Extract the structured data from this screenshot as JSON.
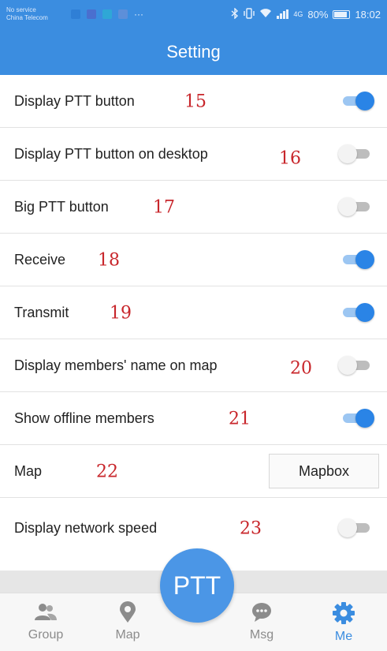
{
  "status_bar": {
    "carrier_line1": "No service",
    "carrier_line2": "China Telecom",
    "dots": "···",
    "icons": [
      "bluetooth-icon",
      "vibrate-icon",
      "wifi-icon",
      "signal-icon"
    ],
    "network": "4G",
    "battery": "80%",
    "time": "18:02"
  },
  "header": {
    "title": "Setting"
  },
  "settings": [
    {
      "label": "Display PTT button",
      "number": "15",
      "control": "toggle",
      "on": true
    },
    {
      "label": "Display PTT button on desktop",
      "number": "16",
      "control": "toggle",
      "on": false
    },
    {
      "label": "Big PTT button",
      "number": "17",
      "control": "toggle",
      "on": false
    },
    {
      "label": "Receive",
      "number": "18",
      "control": "toggle",
      "on": true
    },
    {
      "label": "Transmit",
      "number": "19",
      "control": "toggle",
      "on": true
    },
    {
      "label": "Display members' name on map",
      "number": "20",
      "control": "toggle",
      "on": false
    },
    {
      "label": "Show offline members",
      "number": "21",
      "control": "toggle",
      "on": true
    },
    {
      "label": "Map",
      "number": "22",
      "control": "button",
      "value": "Mapbox"
    },
    {
      "label": "Display network speed",
      "number": "23",
      "control": "toggle",
      "on": false
    }
  ],
  "ptt_button": {
    "label": "PTT"
  },
  "bottom_nav": [
    {
      "label": "Group",
      "icon": "group-icon",
      "active": false
    },
    {
      "label": "Map",
      "icon": "map-pin-icon",
      "active": false
    },
    {
      "label": "Msg",
      "icon": "message-icon",
      "active": false
    },
    {
      "label": "Me",
      "icon": "gear-icon",
      "active": true
    }
  ],
  "colors": {
    "primary": "#3b8de0",
    "toggle_on": "#2a84e6",
    "annotation": "#c8262b"
  }
}
